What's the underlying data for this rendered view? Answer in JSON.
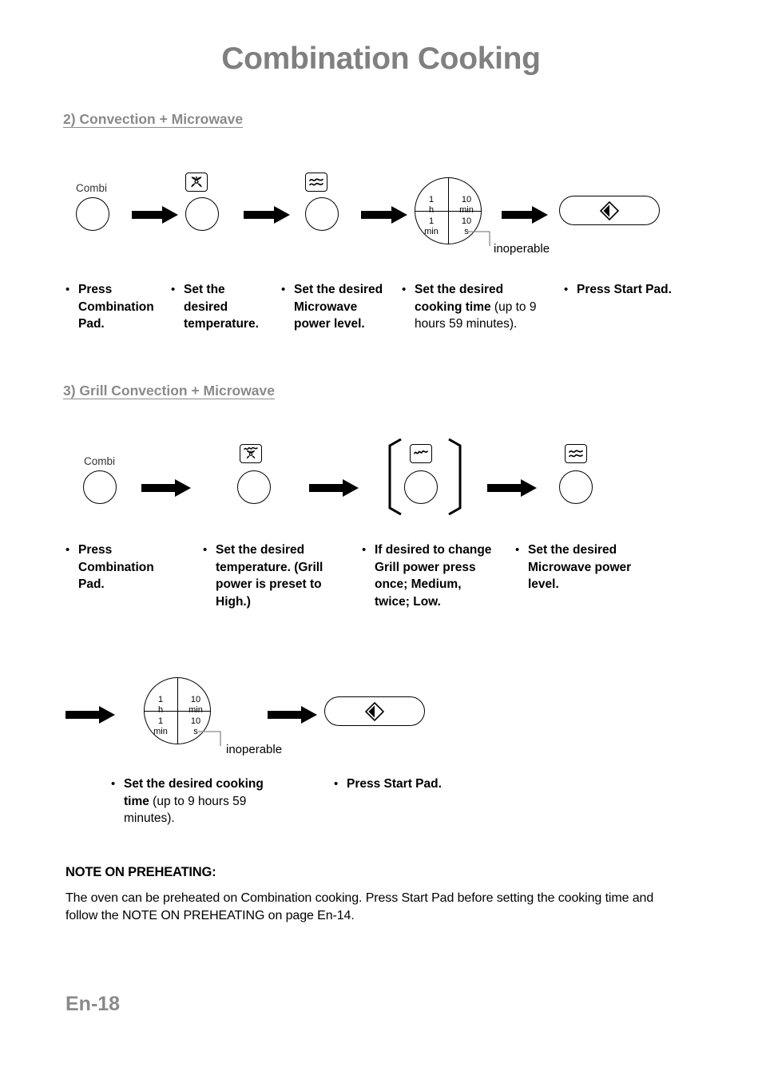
{
  "document": {
    "title": "Combination Cooking",
    "page_number_label": "En-18"
  },
  "sections": [
    {
      "heading": "2) Convection + Microwave",
      "diagram": {
        "knob_label": "Combi",
        "icons": [
          "convection-fan-icon",
          "microwave-waves-icon"
        ],
        "dial": {
          "top_left": "1\nh",
          "top_left_line1": "1",
          "top_left_line2": "h",
          "top_right_line1": "10",
          "top_right_line2": "min",
          "bottom_left_line1": "1",
          "bottom_left_line2": "min",
          "bottom_right_line1": "10",
          "bottom_right_line2": "s",
          "annotation": "inoperable"
        },
        "start_pad_icon": "start-diamond-icon"
      },
      "captions": [
        {
          "bold": "Press Combination Pad.",
          "normal": ""
        },
        {
          "bold": "Set the desired temperature.",
          "normal": ""
        },
        {
          "bold": "Set the desired Microwave power level.",
          "normal": ""
        },
        {
          "bold": "Set the desired cooking time",
          "normal": " (up to 9 hours 59 minutes)."
        },
        {
          "bold": "Press Start Pad.",
          "normal": ""
        }
      ]
    },
    {
      "heading": "3) Grill Convection + Microwave",
      "diagram": {
        "knob_label": "Combi",
        "icons": [
          "grill-convection-icon",
          "grill-icon",
          "microwave-waves-icon"
        ],
        "dial": {
          "top_left_line1": "1",
          "top_left_line2": "h",
          "top_right_line1": "10",
          "top_right_line2": "min",
          "bottom_left_line1": "1",
          "bottom_left_line2": "min",
          "bottom_right_line1": "10",
          "bottom_right_line2": "s",
          "annotation": "inoperable"
        },
        "start_pad_icon": "start-diamond-icon"
      },
      "captions": [
        {
          "bold": "Press Combination Pad.",
          "normal": ""
        },
        {
          "bold": "Set the desired temperature. (Grill power is preset to High.)",
          "normal": ""
        },
        {
          "bold": "If desired to change Grill power press once; Medium, twice; Low.",
          "normal": ""
        },
        {
          "bold": "Set the desired Microwave power level.",
          "normal": ""
        },
        {
          "bold": "Set the desired cooking time",
          "normal": " (up to 9 hours 59 minutes)."
        },
        {
          "bold": "Press Start Pad.",
          "normal": ""
        }
      ]
    }
  ],
  "note": {
    "title": "NOTE ON PREHEATING:",
    "body": "The oven can be preheated on Combination cooking. Press Start Pad before setting the cooking time and follow the NOTE ON PREHEATING on page En-14."
  },
  "colors": {
    "title_gray": "#808080",
    "heading_gray": "#8a8a8a",
    "ink": "#000000"
  }
}
